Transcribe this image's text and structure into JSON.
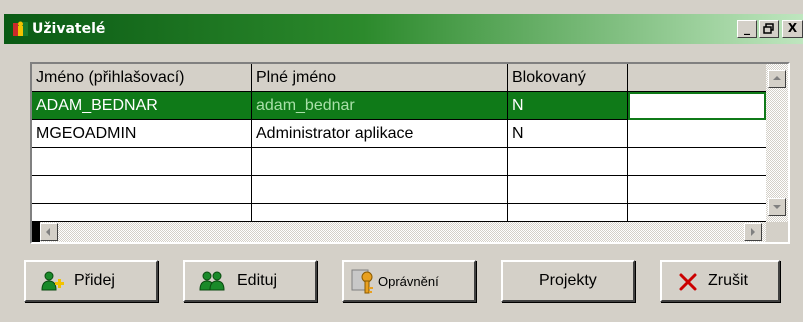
{
  "window": {
    "title": "Uživatelé",
    "controls": {
      "minimize": "_",
      "maximize": "▫",
      "close": "X"
    }
  },
  "table": {
    "columns": [
      "Jméno (přihlašovací)",
      "Plné jméno",
      "Blokovaný",
      ""
    ],
    "rows": [
      {
        "login": "ADAM_BEDNAR",
        "full_name": "adam_bednar",
        "blocked": "N",
        "selected": true
      },
      {
        "login": "MGEOADMIN",
        "full_name": "Administrator aplikace",
        "blocked": "N",
        "selected": false
      }
    ]
  },
  "buttons": {
    "add": "Přidej",
    "edit": "Edituj",
    "permissions": "Oprávnění",
    "projects": "Projekty",
    "cancel": "Zrušit"
  },
  "icons": {
    "app": "users-app-icon",
    "add": "add-user-icon",
    "edit": "edit-user-icon",
    "permissions": "key-permissions-icon",
    "cancel": "cross-icon"
  },
  "colors": {
    "title_start": "#0a5a14",
    "title_end": "#bfe6bf",
    "selection": "#0f7a18",
    "face": "#d4d0c8",
    "cancel_icon": "#cc0000"
  }
}
